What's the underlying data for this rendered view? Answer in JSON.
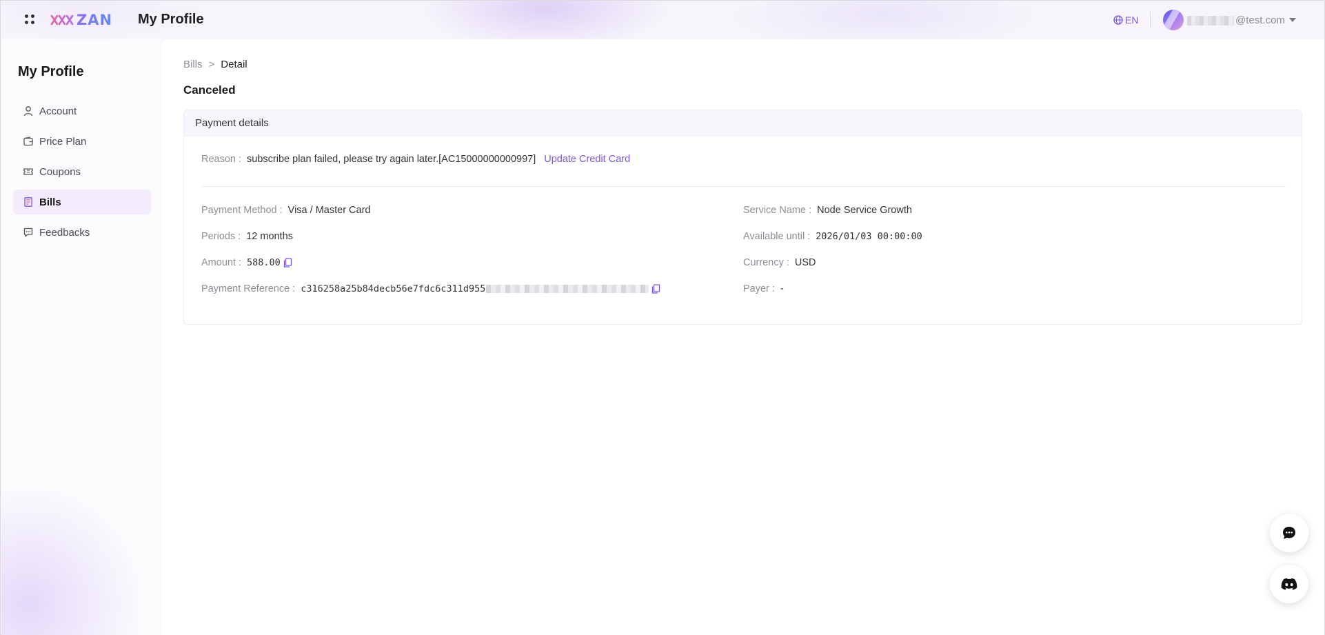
{
  "header": {
    "brand": "ZAN",
    "title": "My Profile",
    "language": "EN",
    "email_suffix": "@test.com",
    "icons": [
      "apps-grid-icon",
      "globe-icon",
      "chevron-down-icon"
    ]
  },
  "sidebar": {
    "title": "My Profile",
    "items": [
      {
        "label": "Account",
        "icon": "user-icon",
        "active": false
      },
      {
        "label": "Price Plan",
        "icon": "wallet-icon",
        "active": false
      },
      {
        "label": "Coupons",
        "icon": "ticket-icon",
        "active": false
      },
      {
        "label": "Bills",
        "icon": "document-icon",
        "active": true
      },
      {
        "label": "Feedbacks",
        "icon": "message-icon",
        "active": false
      }
    ]
  },
  "breadcrumb": {
    "parent": "Bills",
    "separator": ">",
    "current": "Detail"
  },
  "status": "Canceled",
  "payment": {
    "heading": "Payment details",
    "reason_label": "Reason :",
    "reason_value": "subscribe plan failed, please try again later.[AC15000000000997]",
    "update_link": "Update Credit Card",
    "left": [
      {
        "label": "Payment Method :",
        "value": "Visa / Master Card"
      },
      {
        "label": "Periods :",
        "value": "12 months"
      },
      {
        "label": "Amount :",
        "value": "588.00"
      },
      {
        "label": "Payment Reference :",
        "value": "c316258a25b84decb56e7fdc6c311d955"
      }
    ],
    "right": [
      {
        "label": "Service Name :",
        "value": "Node Service Growth"
      },
      {
        "label": "Available until :",
        "value": "2026/01/03 00:00:00"
      },
      {
        "label": "Currency :",
        "value": "USD"
      },
      {
        "label": "Payer :",
        "value": "-"
      }
    ]
  },
  "colors": {
    "accent": "#7b55e0",
    "active_nav_bg": "#f3ecfd",
    "card_head_bg": "#f8f6fd"
  }
}
